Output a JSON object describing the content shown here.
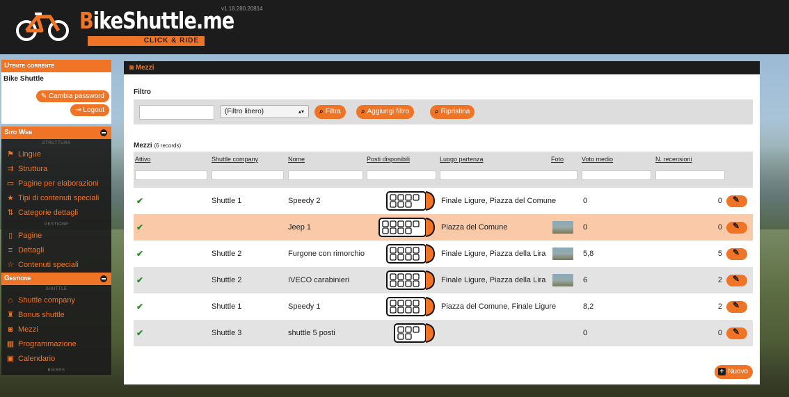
{
  "header": {
    "logo_text_b": "B",
    "logo_text_rest": "ikeShuttle.me",
    "logo_tagline": "CLICK & RIDE",
    "version": "v1.18.280.20814"
  },
  "sidebar": {
    "current_user": {
      "heading": "Utente corrente",
      "name": "Bike Shuttle",
      "change_password_label": "Cambia password",
      "logout_label": "Logout"
    },
    "sections": [
      {
        "heading": "Sito Web",
        "groups": [
          {
            "label": "STRUTTURA",
            "items": [
              {
                "label": "Lingue",
                "icon": "flag-icon"
              },
              {
                "label": "Struttura",
                "icon": "sitemap-icon"
              },
              {
                "label": "Pagine per elaborazioni",
                "icon": "desktop-icon"
              },
              {
                "label": "Tipi di contenuti speciali",
                "icon": "pin-icon"
              },
              {
                "label": "Categorie dettagli",
                "icon": "sort-icon"
              }
            ]
          },
          {
            "label": "GESTIONE",
            "items": [
              {
                "label": "Pagine",
                "icon": "file-icon"
              },
              {
                "label": "Dettagli",
                "icon": "list-icon"
              },
              {
                "label": "Contenuti speciali",
                "icon": "star-icon"
              }
            ]
          }
        ]
      },
      {
        "heading": "Gestione",
        "groups": [
          {
            "label": "SHUTTLE",
            "items": [
              {
                "label": "Shuttle company",
                "icon": "building-icon"
              },
              {
                "label": "Bonus shuttle",
                "icon": "trophy-icon"
              },
              {
                "label": "Mezzi",
                "icon": "bus-icon"
              },
              {
                "label": "Programmazione",
                "icon": "table-icon"
              },
              {
                "label": "Calendario",
                "icon": "calendar-icon"
              }
            ]
          },
          {
            "label": "BIKERS",
            "items": []
          }
        ]
      }
    ]
  },
  "main": {
    "title": "Mezzi",
    "filter": {
      "title": "Filtro",
      "input_value": "",
      "select_value": "(Filtro libero)",
      "filtra_label": "Filtra",
      "aggiungi_label": "Aggiungi filtro",
      "ripristina_label": "Ripristina"
    },
    "table": {
      "title": "Mezzi",
      "count_label": "(6 records)",
      "columns": [
        "Attivo",
        "Shuttle company",
        "Nome",
        "Posti disponibili",
        "Luogo partenza",
        "Foto",
        "Voto medio",
        "N. recensioni"
      ],
      "rows": [
        {
          "attivo": "✔",
          "company": "Shuttle 1",
          "nome": "Speedy 2",
          "seats": 7,
          "luogo": "Finale Ligure, Piazza del Comune",
          "foto": false,
          "voto": "0",
          "recensioni": "0"
        },
        {
          "attivo": "✔",
          "company": "",
          "nome": "Jeep 1",
          "seats": 9,
          "luogo": "Piazza del Comune",
          "foto": true,
          "voto": "0",
          "recensioni": "0"
        },
        {
          "attivo": "✔",
          "company": "Shuttle 2",
          "nome": "Furgone con rimorchio",
          "seats": 8,
          "luogo": "Finale Ligure, Piazza della Lira",
          "foto": true,
          "voto": "5,8",
          "recensioni": "5"
        },
        {
          "attivo": "✔",
          "company": "Shuttle 2",
          "nome": "IVECO carabinieri",
          "seats": 8,
          "luogo": "Finale Ligure, Piazza della Lira",
          "foto": true,
          "voto": "6",
          "recensioni": "2"
        },
        {
          "attivo": "✔",
          "company": "Shuttle 1",
          "nome": "Speedy 1",
          "seats": 8,
          "luogo": "Piazza del Comune, Finale Ligure",
          "foto": false,
          "voto": "8,2",
          "recensioni": "2"
        },
        {
          "attivo": "✔",
          "company": "Shuttle 3",
          "nome": "shuttle 5 posti",
          "seats": 5,
          "luogo": "",
          "foto": false,
          "voto": "0",
          "recensioni": "0"
        }
      ]
    },
    "new_button_label": "Nuovo"
  },
  "colors": {
    "accent": "#f07426",
    "dark": "#1c1c1c",
    "highlight_row": "#f9c9a8",
    "check": "#2f8a2f"
  }
}
